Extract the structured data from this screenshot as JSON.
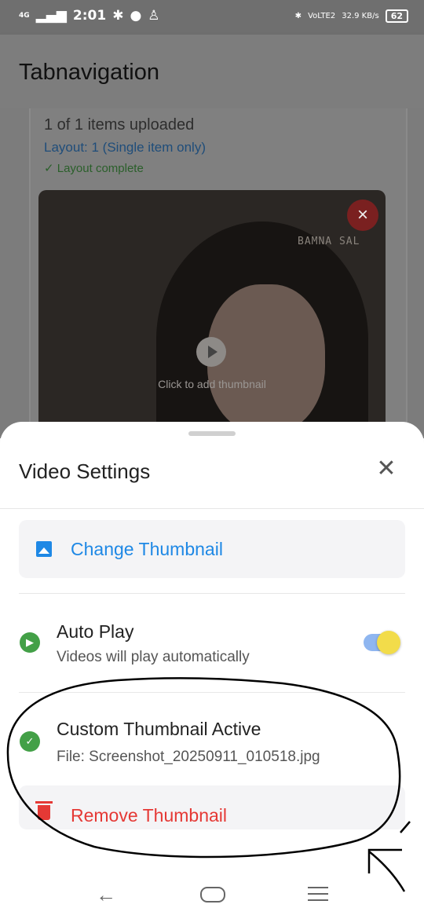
{
  "status_bar": {
    "network": "4G",
    "time": "2:01",
    "lte": "VoLTE2",
    "speed": "32.9 KB/s",
    "battery": "62"
  },
  "app_bar": {
    "title": "Tabnavigation"
  },
  "upload_card": {
    "count_text": "1 of 1 items uploaded",
    "layout_text": "Layout: 1 (Single item only)",
    "layout_status": "✓ Layout complete",
    "watermark": "BAMNA SAL",
    "thumbnail_prompt": "Click to add thumbnail"
  },
  "sheet": {
    "title": "Video Settings",
    "change_thumbnail_label": "Change Thumbnail",
    "auto_play": {
      "title": "Auto Play",
      "subtitle": "Videos will play automatically",
      "enabled": true
    },
    "custom_thumbnail": {
      "title": "Custom Thumbnail Active",
      "file_text": "File: Screenshot_20250911_010518.jpg"
    },
    "remove_thumbnail_label": "Remove Thumbnail"
  },
  "colors": {
    "accent_blue": "#1e88e5",
    "success_green": "#43a047",
    "danger_red": "#e53935",
    "toggle_thumb": "#f2dc4a"
  },
  "icons": {
    "change_thumbnail": "image-icon",
    "auto_play": "play-circle-icon",
    "custom_thumbnail": "check-circle-icon",
    "remove": "trash-icon"
  }
}
